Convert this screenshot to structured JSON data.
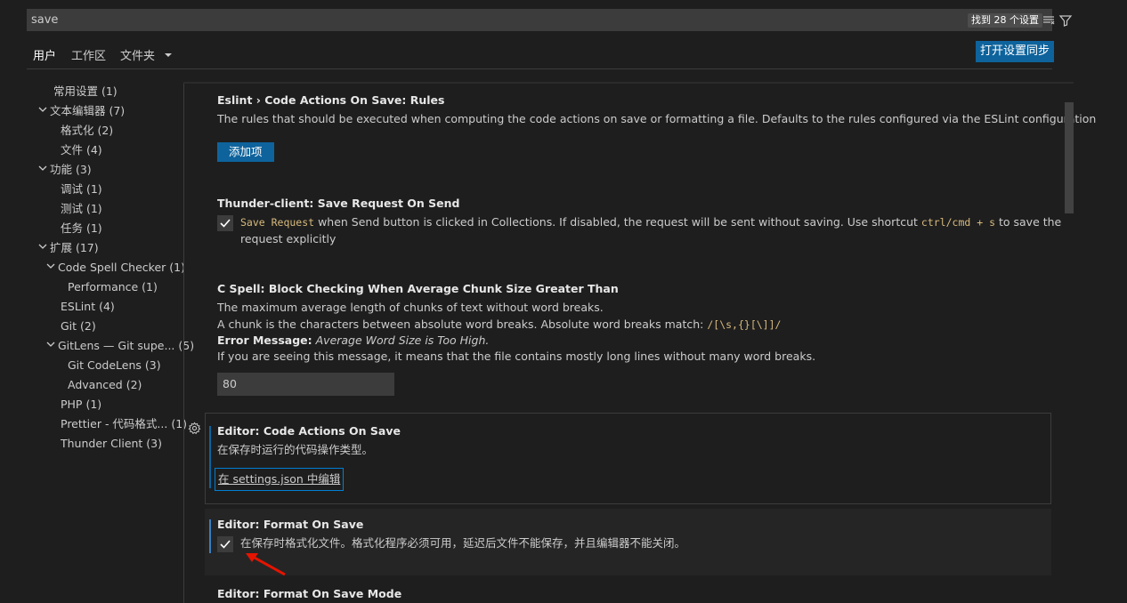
{
  "search": {
    "value": "save",
    "result_count": "找到 28 个设置"
  },
  "tabs": {
    "user": "用户",
    "workspace": "工作区",
    "folder": "文件夹"
  },
  "sync_button": "打开设置同步",
  "toc": [
    {
      "label": "常用设置 (1)"
    },
    {
      "label": "文本编辑器 (7)"
    },
    {
      "label": "格式化 (2)"
    },
    {
      "label": "文件 (4)"
    },
    {
      "label": "功能 (3)"
    },
    {
      "label": "调试 (1)"
    },
    {
      "label": "测试 (1)"
    },
    {
      "label": "任务 (1)"
    },
    {
      "label": "扩展 (17)"
    },
    {
      "label": "Code Spell Checker (1)"
    },
    {
      "label": "Performance (1)"
    },
    {
      "label": "ESLint (4)"
    },
    {
      "label": "Git (2)"
    },
    {
      "label": "GitLens — Git supe... (5)"
    },
    {
      "label": "Git CodeLens (3)"
    },
    {
      "label": "Advanced (2)"
    },
    {
      "label": "PHP (1)"
    },
    {
      "label": "Prettier - 代码格式... (1)"
    },
    {
      "label": "Thunder Client (3)"
    }
  ],
  "settings": {
    "eslint": {
      "category": "Eslint › Code Actions On Save: ",
      "name": "Rules",
      "desc": "The rules that should be executed when computing the code actions on save or formatting a file. Defaults to the rules configured via the ESLint configuration",
      "add_button": "添加项"
    },
    "thunder": {
      "category": "Thunder-client: ",
      "name": "Save Request On Send",
      "code1": "Save Request",
      "desc1": " when Send button is clicked in Collections. If disabled, the request will be sent without saving. Use shortcut ",
      "code2": "ctrl/cmd + s",
      "desc2": " to save the",
      "desc3": "request explicitly",
      "checked": true
    },
    "cspell": {
      "category": "C Spell: ",
      "name": "Block Checking When Average Chunk Size Greater Than",
      "line1": "The maximum average length of chunks of text without word breaks.",
      "line2": "A chunk is the characters between absolute word breaks. Absolute word breaks match: ",
      "line2_code": "/[\\s,{}[\\]]/",
      "line3_bold": "Error Message:",
      "line3_italic": " Average Word Size is Too High.",
      "line4": "If you are seeing this message, it means that the file contains mostly long lines without many word breaks.",
      "value": "80"
    },
    "code_actions": {
      "category": "Editor: ",
      "name": "Code Actions On Save",
      "desc": "在保存时运行的代码操作类型。",
      "link": "在 settings.json 中编辑"
    },
    "format_on_save": {
      "category": "Editor: ",
      "name": "Format On Save",
      "desc": "在保存时格式化文件。格式化程序必须可用，延迟后文件不能保存，并且编辑器不能关闭。",
      "checked": true
    },
    "format_on_save_mode": {
      "category": "Editor: ",
      "name": "Format On Save Mode"
    }
  },
  "colors": {
    "accent": "#0e639c",
    "annotation_arrow": "#e51400"
  }
}
